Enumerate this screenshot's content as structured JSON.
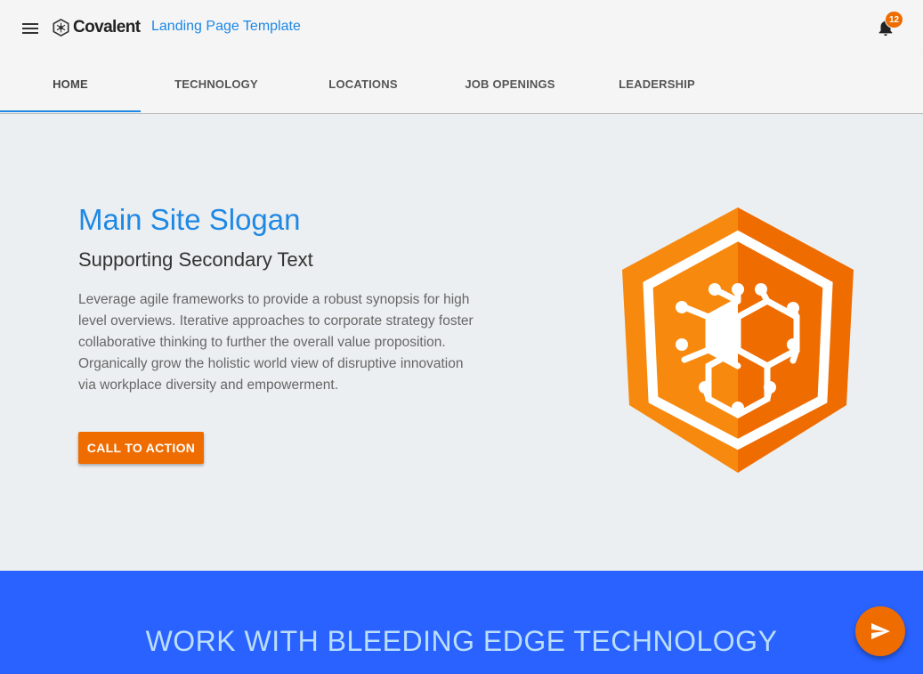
{
  "toolbar": {
    "brand": "Covalent",
    "app_title": "Landing Page Template",
    "menu_icon": "menu-icon",
    "notifications_icon": "bell-icon",
    "notifications_count": "12"
  },
  "tabs": [
    {
      "label": "HOME",
      "active": true
    },
    {
      "label": "TECHNOLOGY",
      "active": false
    },
    {
      "label": "LOCATIONS",
      "active": false
    },
    {
      "label": "JOB OPENINGS",
      "active": false
    },
    {
      "label": "LEADERSHIP",
      "active": false
    }
  ],
  "hero": {
    "slogan": "Main Site Slogan",
    "secondary": "Supporting Secondary Text",
    "body": "Leverage agile frameworks to provide a robust synopsis for high level overviews. Iterative approaches to corporate strategy foster collaborative thinking to further the overall value proposition. Organically grow the holistic world view of disruptive innovation via workplace diversity and empowerment.",
    "cta_label": "CALL TO ACTION"
  },
  "section": {
    "heading": "WORK WITH BLEEDING EDGE TECHNOLOGY"
  },
  "fab": {
    "icon": "send-icon"
  },
  "colors": {
    "primary": "#1e88e5",
    "accent": "#ef6c00",
    "section_blue": "#2962ff",
    "background": "#eceff1"
  }
}
